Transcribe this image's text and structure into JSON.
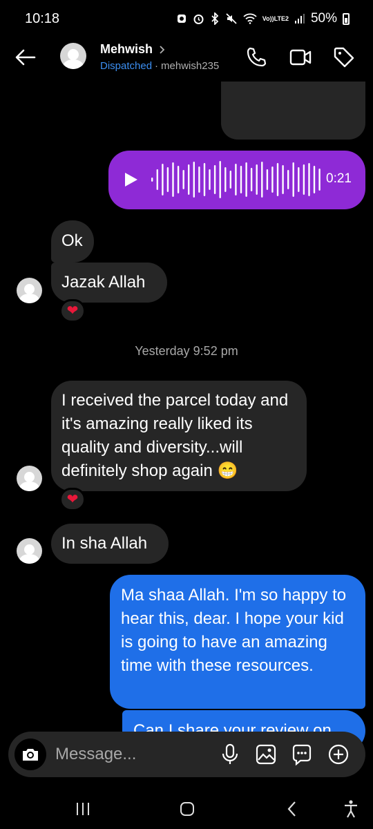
{
  "status_bar": {
    "time": "10:18",
    "lte_top": "Vo))",
    "lte_bottom": "LTE2",
    "battery": "50%"
  },
  "header": {
    "contact_name": "Mehwish",
    "status": "Dispatched",
    "separator": "·",
    "username": "mehwish235",
    "icons": [
      "back-arrow-icon",
      "chevron-right-icon",
      "phone-icon",
      "video-camera-icon",
      "tag-icon"
    ]
  },
  "messages": {
    "voice_duration": "0:21",
    "ok": "Ok",
    "jazak": "Jazak Allah",
    "reaction_heart": "❤",
    "timestamp": "Yesterday 9:52 pm",
    "parcel": "I received the parcel today and it's amazing really liked its quality and diversity...will definitely shop again 😁",
    "insha": "In sha Allah",
    "reply": "Ma shaa Allah. I'm so happy to hear this, dear. I hope your kid is going to have an amazing time with these resources.",
    "partial": "Can I share your review on"
  },
  "input_bar": {
    "placeholder": "Message...",
    "icons": [
      "camera-icon",
      "microphone-icon",
      "gallery-icon",
      "sticker-icon",
      "plus-circle-icon"
    ]
  },
  "colors": {
    "incoming_bubble": "#262626",
    "outgoing_bubble": "#1f6fe8",
    "voice_bubble": "#8e2ad6",
    "status_link": "#3c8ff2",
    "heart": "#e8183a"
  }
}
